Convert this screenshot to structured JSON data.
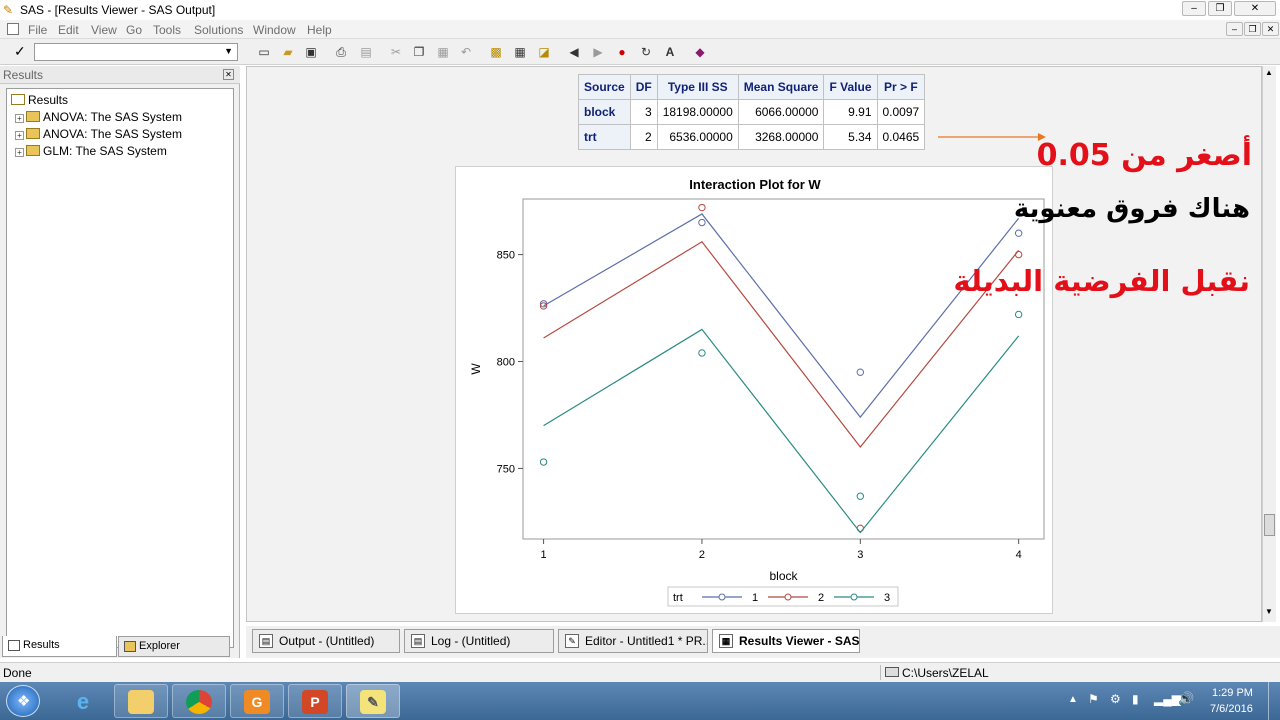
{
  "window": {
    "title": "SAS - [Results Viewer - SAS Output]",
    "controls": [
      "–",
      "❐",
      "✕"
    ],
    "child_controls": [
      "–",
      "❐",
      "✕"
    ]
  },
  "menu": [
    "File",
    "Edit",
    "View",
    "Go",
    "Tools",
    "Solutions",
    "Window",
    "Help"
  ],
  "toolbar": {
    "command_value": "",
    "icons": [
      "new-icon",
      "open-icon",
      "save-icon",
      "print-icon",
      "print-preview-icon",
      "cut-icon",
      "copy-icon",
      "paste-icon",
      "undo-icon",
      "new-library-icon",
      "sas-explorer-icon",
      "find-icon",
      "back-icon",
      "forward-icon",
      "stop-icon",
      "refresh-icon",
      "font-icon",
      "help-book-icon"
    ]
  },
  "left_panel": {
    "header": "Results",
    "tree": {
      "root": "Results",
      "items": [
        "ANOVA:  The SAS System",
        "ANOVA:  The SAS System",
        "GLM:  The SAS System"
      ]
    },
    "tabs": [
      "Results",
      "Explorer"
    ]
  },
  "anova_table": {
    "headers": [
      "Source",
      "DF",
      "Type III SS",
      "Mean Square",
      "F Value",
      "Pr > F"
    ],
    "rows": [
      [
        "block",
        "3",
        "18198.00000",
        "6066.00000",
        "9.91",
        "0.0097"
      ],
      [
        "trt",
        "2",
        "6536.00000",
        "3268.00000",
        "5.34",
        "0.0465"
      ]
    ]
  },
  "annotations": {
    "line1": "أصغر من 0.05",
    "line2": "هناك فروق معنوية",
    "line3": "نقبل الفرضية البديلة",
    "arrow_color": "#e87722",
    "red": "#e3101a"
  },
  "chart_data": {
    "type": "line",
    "title": "Interaction Plot for W",
    "xlabel": "block",
    "ylabel": "W",
    "x": [
      1,
      2,
      3,
      4
    ],
    "xticks": [
      "1",
      "2",
      "3",
      "4"
    ],
    "yticks": [
      "750",
      "800",
      "850"
    ],
    "ylim": [
      717,
      876
    ],
    "legend_title": "trt",
    "legend_position": "bottom",
    "series": [
      {
        "name": "1",
        "color": "#5b6ea9",
        "fitted": [
          826,
          869,
          774,
          867
        ],
        "observed": [
          827,
          865,
          795,
          860
        ]
      },
      {
        "name": "2",
        "color": "#b5493f",
        "fitted": [
          811,
          856,
          760,
          852
        ],
        "observed": [
          826,
          872,
          722,
          850
        ]
      },
      {
        "name": "3",
        "color": "#2a8a85",
        "fitted": [
          770,
          815,
          720,
          812
        ],
        "observed": [
          753,
          804,
          737,
          822
        ]
      }
    ]
  },
  "window_tabs": [
    {
      "label": "Output - (Untitled)",
      "active": false
    },
    {
      "label": "Log - (Untitled)",
      "active": false
    },
    {
      "label": "Editor - Untitled1 *   PR...",
      "active": false
    },
    {
      "label": "Results Viewer - SAS ...",
      "active": true
    }
  ],
  "status": {
    "left": "Done",
    "path": "C:\\Users\\ZELAL"
  },
  "taskbar": {
    "apps": [
      "windows-explorer",
      "internet-explorer",
      "file-explorer",
      "chrome",
      "pdf",
      "powerpoint",
      "sas"
    ],
    "time": "1:29 PM",
    "date": "7/6/2016"
  }
}
